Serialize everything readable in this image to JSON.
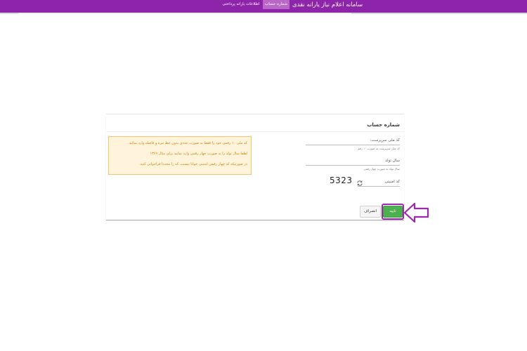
{
  "header": {
    "brand": "سامانه اعلام نیاز یارانه نقدی",
    "tabs": [
      {
        "label": "شماره حساب",
        "active": true
      },
      {
        "label": "اطلاعات یارانه پرداختی",
        "active": false
      }
    ],
    "background_color": "#8e24aa",
    "active_tab_color": "#ba68c8"
  },
  "form": {
    "title": "شماره حساب",
    "fields": [
      {
        "label": "کد ملی سرپرست:",
        "hint": "کد ملی سرپرست به صورت ۱۰ رقم"
      },
      {
        "label": "سال تولد",
        "hint": "سال تولد به صورت چهار رقمی"
      },
      {
        "label": "کد امنیتی",
        "hint": ""
      }
    ],
    "captcha_code": "5323",
    "refresh_icon": "refresh-icon",
    "warning_lines": [
      "کد ملی ۱۰ رقمی خود را فقط به صورت عددی بدون خط تیره و فاصله وارد نمائید.",
      "لطفا سال تولد را به صورت چهار رقمی وارد نمایید برای مثال ۱۳۶۹",
      "در صورتیکه کد چهار رقمی امنیتی خوانا نیست، که را مجددا فراخوانی کنید."
    ],
    "buttons": {
      "cancel": "انصراف",
      "confirm": "تایید"
    },
    "confirm_color": "#4caf50",
    "highlight_color": "#9c27b0"
  }
}
